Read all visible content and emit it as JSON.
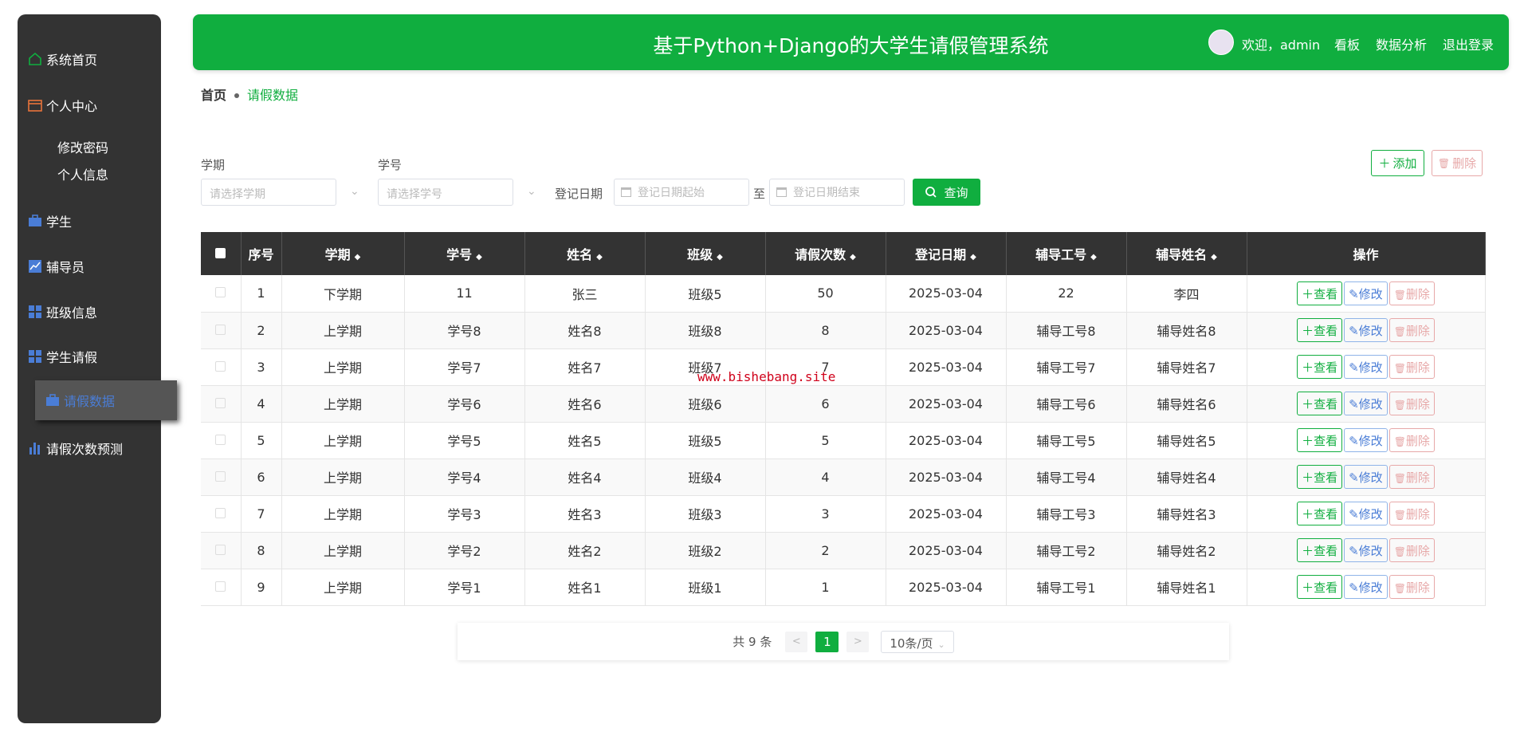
{
  "sidebar": {
    "items": [
      {
        "label": "系统首页",
        "icon": "home-icon"
      },
      {
        "label": "个人中心",
        "icon": "wallet-icon"
      },
      {
        "label": "学生",
        "icon": "briefcase-icon"
      },
      {
        "label": "辅导员",
        "icon": "chart-icon"
      },
      {
        "label": "班级信息",
        "icon": "grid-icon"
      },
      {
        "label": "学生请假",
        "icon": "grid-icon"
      },
      {
        "label": "请假数据",
        "icon": "briefcase-icon",
        "active": true
      },
      {
        "label": "请假次数预测",
        "icon": "bar-chart-icon"
      }
    ],
    "sub_items": [
      "修改密码",
      "个人信息"
    ]
  },
  "header": {
    "title": "基于Python+Django的大学生请假管理系统",
    "welcome": "欢迎，admin",
    "links": [
      "看板",
      "数据分析",
      "退出登录"
    ]
  },
  "breadcrumb": {
    "home": "首页",
    "current": "请假数据"
  },
  "filters": {
    "term_label": "学期",
    "term_placeholder": "请选择学期",
    "id_label": "学号",
    "id_placeholder": "请选择学号",
    "date_label": "登记日期",
    "date_start": "登记日期起始",
    "date_to": "至",
    "date_end": "登记日期结束",
    "query": "查询"
  },
  "actions": {
    "add": "添加",
    "delete": "删除"
  },
  "table": {
    "headers": [
      "序号",
      "学期",
      "学号",
      "姓名",
      "班级",
      "请假次数",
      "登记日期",
      "辅导工号",
      "辅导姓名",
      "操作"
    ],
    "rows": [
      [
        "1",
        "下学期",
        "11",
        "张三",
        "班级5",
        "50",
        "2025-03-04",
        "22",
        "李四"
      ],
      [
        "2",
        "上学期",
        "学号8",
        "姓名8",
        "班级8",
        "8",
        "2025-03-04",
        "辅导工号8",
        "辅导姓名8"
      ],
      [
        "3",
        "上学期",
        "学号7",
        "姓名7",
        "班级7",
        "7",
        "2025-03-04",
        "辅导工号7",
        "辅导姓名7"
      ],
      [
        "4",
        "上学期",
        "学号6",
        "姓名6",
        "班级6",
        "6",
        "2025-03-04",
        "辅导工号6",
        "辅导姓名6"
      ],
      [
        "5",
        "上学期",
        "学号5",
        "姓名5",
        "班级5",
        "5",
        "2025-03-04",
        "辅导工号5",
        "辅导姓名5"
      ],
      [
        "6",
        "上学期",
        "学号4",
        "姓名4",
        "班级4",
        "4",
        "2025-03-04",
        "辅导工号4",
        "辅导姓名4"
      ],
      [
        "7",
        "上学期",
        "学号3",
        "姓名3",
        "班级3",
        "3",
        "2025-03-04",
        "辅导工号3",
        "辅导姓名3"
      ],
      [
        "8",
        "上学期",
        "学号2",
        "姓名2",
        "班级2",
        "2",
        "2025-03-04",
        "辅导工号2",
        "辅导姓名2"
      ],
      [
        "9",
        "上学期",
        "学号1",
        "姓名1",
        "班级1",
        "1",
        "2025-03-04",
        "辅导工号1",
        "辅导姓名1"
      ]
    ],
    "row_actions": {
      "view": "查看",
      "edit": "修改",
      "delete": "删除"
    }
  },
  "pagination": {
    "total": "共 9 条",
    "prev": "<",
    "current": "1",
    "next": ">",
    "page_size": "10条/页"
  },
  "watermark": "www.bishebang.site",
  "colors": {
    "primary": "#10ae3f",
    "sidebar_bg": "#333333",
    "danger": "#e7a8a8",
    "info": "#4a7dd6"
  }
}
